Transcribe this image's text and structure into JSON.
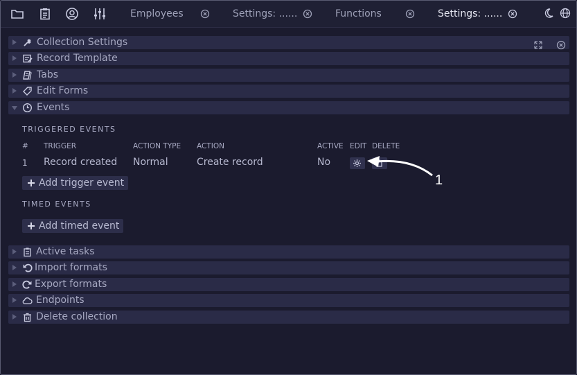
{
  "toolbar": {
    "icons": [
      "folder-icon",
      "clipboard-icon",
      "account-icon",
      "sliders-icon"
    ]
  },
  "tabs": [
    {
      "label": "Employees",
      "active": false
    },
    {
      "label": "Settings: ......",
      "active": false
    },
    {
      "label": "Functions",
      "active": false
    },
    {
      "label": "Settings: ......",
      "active": true
    }
  ],
  "header_right_icons": [
    "moon-icon",
    "globe-icon"
  ],
  "sections_top": [
    {
      "label": "Collection Settings",
      "icon": "wrench-icon",
      "expanded": false
    },
    {
      "label": "Record Template",
      "icon": "note-icon",
      "expanded": false
    },
    {
      "label": "Tabs",
      "icon": "documents-icon",
      "expanded": false
    },
    {
      "label": "Edit Forms",
      "icon": "tag-icon",
      "expanded": false
    },
    {
      "label": "Events",
      "icon": "clock-icon",
      "expanded": true
    }
  ],
  "events": {
    "triggered_title": "TRIGGERED EVENTS",
    "columns": [
      "#",
      "TRIGGER",
      "ACTION TYPE",
      "ACTION",
      "ACTIVE",
      "EDIT",
      "DELETE"
    ],
    "rows": [
      {
        "num": "1",
        "trigger": "Record created",
        "action_type": "Normal",
        "action": "Create record",
        "active": "No"
      }
    ],
    "add_trigger_label": "Add trigger event",
    "timed_title": "TIMED EVENTS",
    "add_timed_label": "Add timed event"
  },
  "sections_bottom": [
    {
      "label": "Active tasks",
      "icon": "clipboard-icon"
    },
    {
      "label": "Import formats",
      "icon": "undo-icon"
    },
    {
      "label": "Export formats",
      "icon": "redo-icon"
    },
    {
      "label": "Endpoints",
      "icon": "cloud-icon"
    },
    {
      "label": "Delete collection",
      "icon": "trash-icon"
    }
  ],
  "annotation": {
    "label": "1"
  },
  "colors": {
    "background": "#1b1b2e",
    "bar": "#2a2b47",
    "text": "#b7b9d0",
    "annotation": "#ffffff"
  }
}
